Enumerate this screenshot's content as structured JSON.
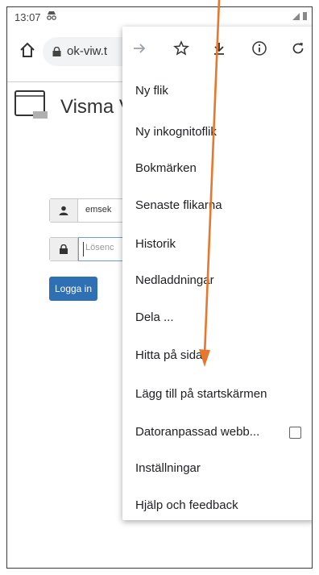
{
  "status_bar": {
    "time": "13:07",
    "indicator_icon": "incognito-icon",
    "right_icons": "signal-battery"
  },
  "toolbar": {
    "url": "ok-viw.t"
  },
  "page": {
    "brand": "Visma V",
    "username_value": "emsek",
    "password_placeholder": "Lösenc",
    "login_label": "Logga in"
  },
  "menu": {
    "top_icons": [
      "forward-icon",
      "star-icon",
      "download-icon",
      "info-icon",
      "refresh-icon"
    ],
    "items": [
      {
        "label": "Ny flik"
      },
      {
        "label": "Ny inkognitoflik"
      },
      {
        "label": "Bokmärken"
      },
      {
        "label": "Senaste flikarna"
      },
      {
        "label": "Historik"
      },
      {
        "label": "Nedladdningar"
      },
      {
        "label": "Dela ..."
      },
      {
        "label": "Hitta på sida"
      },
      {
        "label": "Lägg till på startskärmen"
      },
      {
        "label": "Datoranpassad webb...",
        "checkbox": false
      },
      {
        "label": "Inställningar"
      },
      {
        "label": "Hjälp och feedback"
      }
    ]
  },
  "colors": {
    "annotation_arrow": "#e8772e",
    "login_button": "#2f6fb3"
  }
}
